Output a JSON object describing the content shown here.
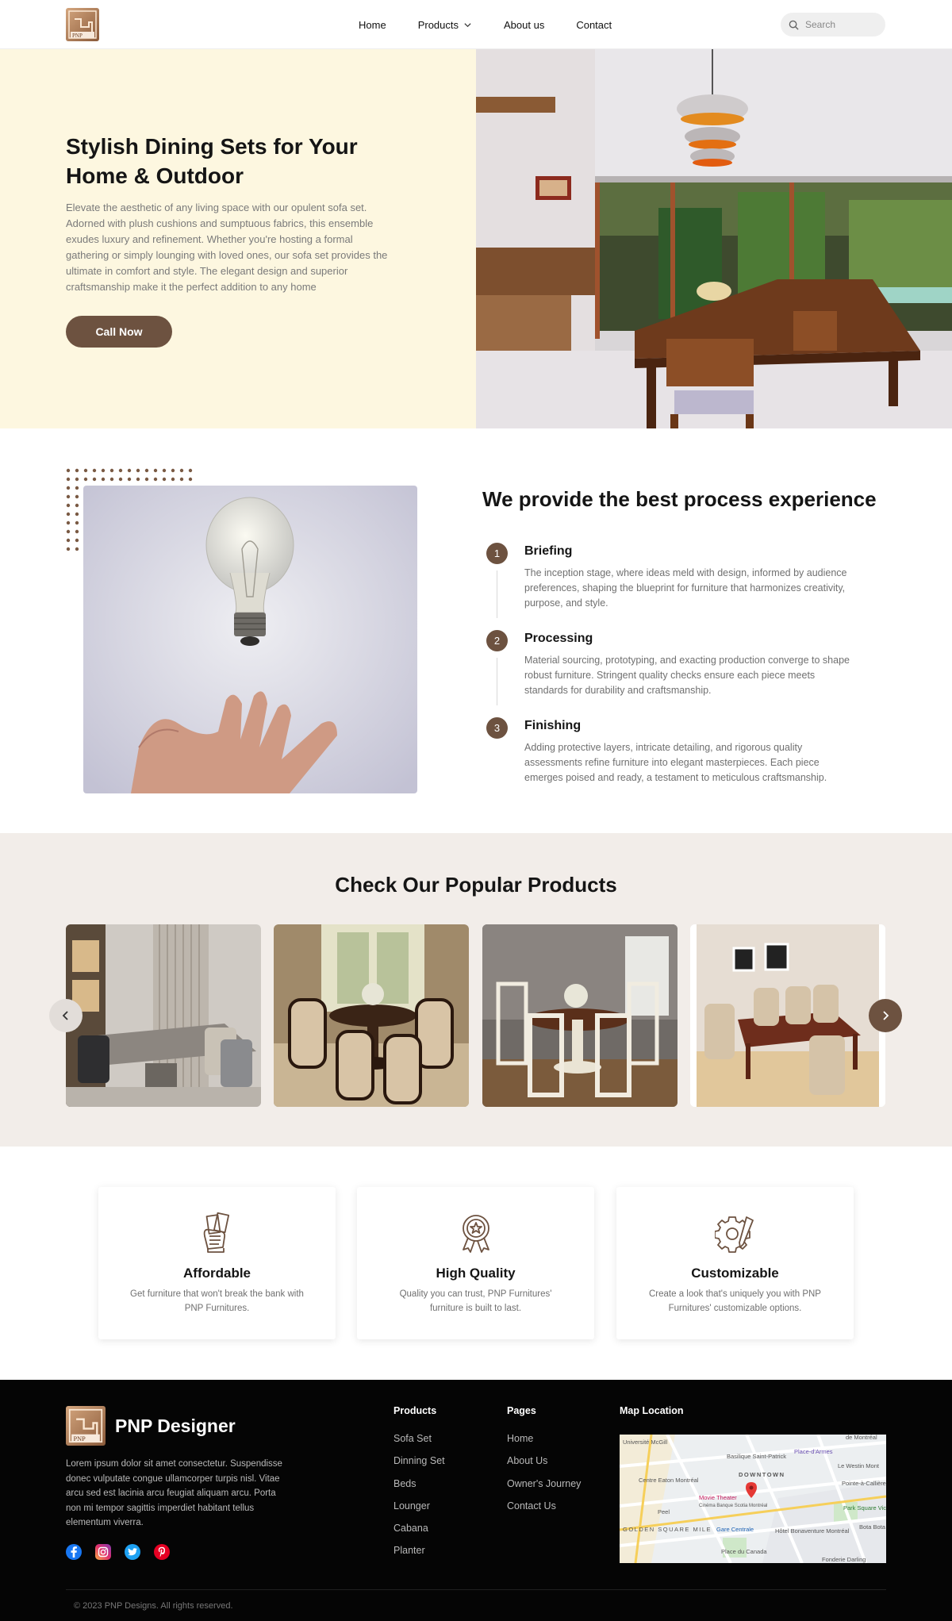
{
  "nav": {
    "links": [
      "Home",
      "Products",
      "About us",
      "Contact"
    ],
    "search_placeholder": "Search"
  },
  "hero": {
    "title": "Stylish Dining Sets for Your Home & Outdoor",
    "text": "Elevate the aesthetic of any living space with our opulent sofa set. Adorned with plush cushions and sumptuous fabrics, this ensemble exudes luxury and refinement. Whether you're hosting a formal gathering or simply lounging with loved ones, our sofa set provides the ultimate in comfort and style. The elegant design and superior craftsmanship make it the perfect addition to any home",
    "button": "Call Now"
  },
  "process": {
    "title": "We provide the best process experience",
    "steps": [
      {
        "num": "1",
        "title": "Briefing",
        "text": "The inception stage, where ideas meld with design, informed by audience preferences, shaping the blueprint for furniture that harmonizes creativity, purpose, and style."
      },
      {
        "num": "2",
        "title": "Processing",
        "text": "Material sourcing, prototyping, and exacting production converge to shape robust furniture. Stringent quality checks ensure each piece meets standards for durability and craftsmanship."
      },
      {
        "num": "3",
        "title": "Finishing",
        "text": "Adding protective layers, intricate detailing, and rigorous quality assessments refine furniture into elegant masterpieces. Each piece emerges poised and ready, a testament to meticulous craftsmanship."
      }
    ]
  },
  "popular": {
    "title": "Check Our Popular Products"
  },
  "features": [
    {
      "icon": "money-hand-icon",
      "title": "Affordable",
      "text": "Get furniture that won't break the bank with PNP Furnitures."
    },
    {
      "icon": "award-badge-icon",
      "title": "High Quality",
      "text": "Quality you can trust, PNP Furnitures' furniture is built to last."
    },
    {
      "icon": "gear-pencil-icon",
      "title": "Customizable",
      "text": "Create a look that's uniquely you with PNP Furnitures' customizable options."
    }
  ],
  "footer": {
    "brand": "PNP Designer",
    "description": "Lorem ipsum dolor sit amet consectetur. Suspendisse donec vulputate congue ullamcorper turpis nisl. Vitae arcu sed est lacinia arcu feugiat aliquam arcu. Porta non mi tempor sagittis imperdiet habitant tellus elementum viverra.",
    "products_heading": "Products",
    "products": [
      "Sofa Set",
      "Dinning Set",
      "Beds",
      "Lounger",
      "Cabana",
      "Planter"
    ],
    "pages_heading": "Pages",
    "pages": [
      "Home",
      "About Us",
      "Owner's Journey",
      "Contact Us"
    ],
    "map_heading": "Map Location",
    "map_labels": [
      "Université McGill",
      "Basilique Saint-Patrick",
      "Place-d'Armes",
      "Le Westin Mont",
      "Centre Eaton Montréal",
      "DOWNTOWN",
      "Pointe-à-Callière",
      "Movie Theater",
      "Cinéma Banque Scotia Montréal",
      "Peel",
      "Gare Centrale",
      "Park Square Victoria",
      "GOLDEN SQUARE MILE",
      "Hôtel Bonaventure Montréal",
      "Place du Canada",
      "Bota Bota",
      "Fonderie Darling",
      "de Montréal"
    ],
    "copyright": "© 2023 PNP Designs. All rights reserved."
  },
  "colors": {
    "brand": "#6d5240",
    "hero_bg": "#fdf7e0",
    "section_bg": "#f2ede9",
    "footer_bg": "#050505"
  }
}
